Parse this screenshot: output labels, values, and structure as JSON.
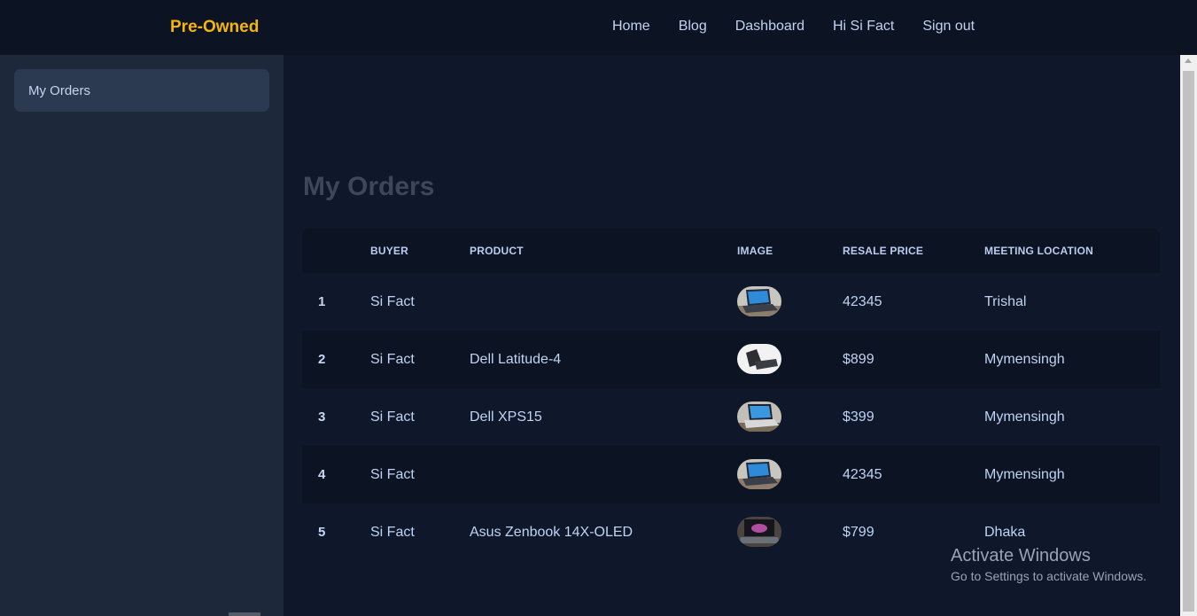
{
  "brand": "Pre-Owned",
  "nav": {
    "home": "Home",
    "blog": "Blog",
    "dashboard": "Dashboard",
    "greeting": "Hi Si Fact",
    "signout": "Sign out"
  },
  "sidebar": {
    "items": [
      {
        "label": "My Orders"
      }
    ]
  },
  "main": {
    "title": "My Orders"
  },
  "table": {
    "headers": [
      "",
      "BUYER",
      "PRODUCT",
      "IMAGE",
      "RESALE PRICE",
      "MEETING LOCATION"
    ],
    "rows": [
      {
        "index": "1",
        "buyer": "Si Fact",
        "product": "",
        "image": "laptop-photo-1",
        "price": "42345",
        "location": "Trishal"
      },
      {
        "index": "2",
        "buyer": "Si Fact",
        "product": "Dell Latitude-4",
        "image": "laptop-photo-2",
        "price": "$899",
        "location": "Mymensingh"
      },
      {
        "index": "3",
        "buyer": "Si Fact",
        "product": "Dell XPS15",
        "image": "laptop-photo-3",
        "price": "$399",
        "location": "Mymensingh"
      },
      {
        "index": "4",
        "buyer": "Si Fact",
        "product": "",
        "image": "laptop-photo-1",
        "price": "42345",
        "location": "Mymensingh"
      },
      {
        "index": "5",
        "buyer": "Si Fact",
        "product": "Asus Zenbook 14X-OLED",
        "image": "laptop-photo-5",
        "price": "$799",
        "location": "Dhaka"
      }
    ]
  },
  "watermark": {
    "title": "Activate Windows",
    "subtitle": "Go to Settings to activate Windows."
  },
  "colors": {
    "brand": "#f5b50a",
    "background": "#0f172a",
    "sidebar": "#1d283a",
    "accent_text": "#bfd3f2"
  }
}
